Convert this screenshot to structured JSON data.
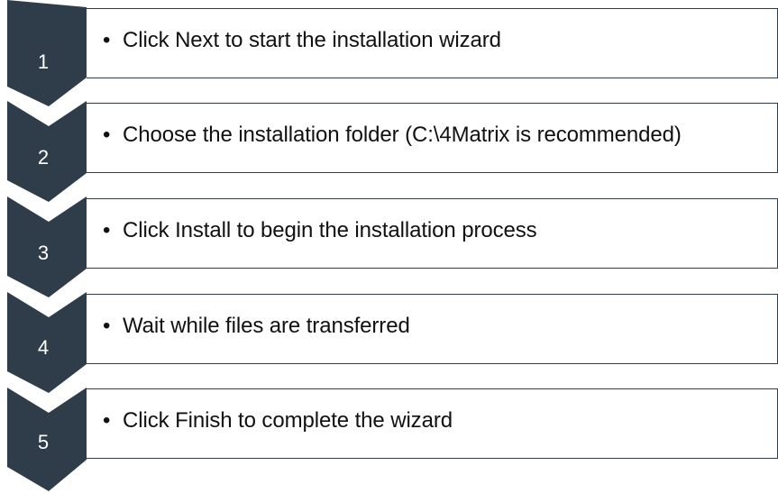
{
  "colors": {
    "chevron_fill": "#2f3d4a",
    "box_border": "#2f3d4a",
    "number_text": "#ffffff",
    "body_text": "#111111"
  },
  "steps": [
    {
      "number": "1",
      "text": "Click Next to start the installation wizard"
    },
    {
      "number": "2",
      "text": "Choose the installation folder (C:\\4Matrix is recommended)"
    },
    {
      "number": "3",
      "text": "Click Install to begin the installation process"
    },
    {
      "number": "4",
      "text": "Wait while files are transferred"
    },
    {
      "number": "5",
      "text": "Click Finish to complete the wizard"
    }
  ]
}
